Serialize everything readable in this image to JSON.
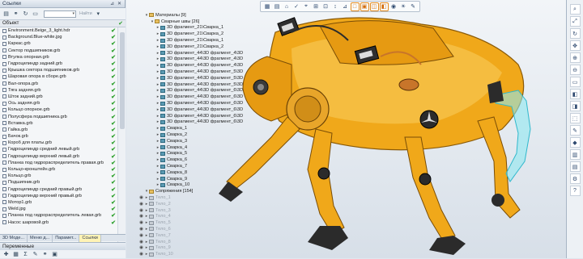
{
  "left_panel": {
    "title": "Ссылки",
    "find_label": "Найти",
    "column_header": "Объект",
    "items": [
      "Environment.Beige_3_light.hdr",
      "Background.Blue-white.jpg",
      "Каркас.grb",
      "Сектор подшипников.grb",
      "Втулка опорная.grb",
      "Гидроцилиндр задний.grb",
      "Крышка сектора подшипников.grb",
      "Шаровая опора в сборе.grb",
      "Вал-опора.grb",
      "Тяга задняя.grb",
      "Шток задний.grb",
      "Ось задняя.grb",
      "Кольцо опорное.grb",
      "Полусфера подшипника.grb",
      "Вставка.grb",
      "Гайка.grb",
      "Бачок.grb",
      "Короб для платы.grb",
      "Гидроцилиндр средний левый.grb",
      "Гидроцилиндр верхний левый.grb",
      "Планка под гидрораспределитель правая.grb",
      "Кольцо-кронштейн.grb",
      "Кольцо.grb",
      "Подшипник.grb",
      "Гидроцилиндр средний правый.grb",
      "Гидроцилиндр верхний правый.grb",
      "Мотор1.grb",
      "Weld.jpg",
      "Планка под гидрораспределитель левая.grb",
      "Насос шаровой.grb"
    ],
    "tabs": [
      "3D Моде...",
      "Меню д...",
      "Парамет...",
      "Ссылки"
    ],
    "bottom_title": "Переменные"
  },
  "tree": {
    "rows": [
      {
        "label": "Материалы [9]",
        "level": 0,
        "type": "fold"
      },
      {
        "label": "Сварные швы [26]",
        "level": 1,
        "type": "fold"
      },
      {
        "label": "3D фрагмент_21\\Сварка_1",
        "level": 2,
        "type": "part"
      },
      {
        "label": "3D фрагмент_21\\Сварка_2",
        "level": 2,
        "type": "part"
      },
      {
        "label": "3D фрагмент_21\\Сварка_1",
        "level": 2,
        "type": "part"
      },
      {
        "label": "3D фрагмент_21\\Сварка_2",
        "level": 2,
        "type": "part"
      },
      {
        "label": "3D фрагмент_44\\3D фрагмент_4\\3D",
        "level": 2,
        "type": "part"
      },
      {
        "label": "3D фрагмент_44\\3D фрагмент_4\\3D",
        "level": 2,
        "type": "part"
      },
      {
        "label": "3D фрагмент_44\\3D фрагмент_4\\3D",
        "level": 2,
        "type": "part"
      },
      {
        "label": "3D фрагмент_44\\3D фрагмент_5\\3D",
        "level": 2,
        "type": "part"
      },
      {
        "label": "3D фрагмент_44\\3D фрагмент_5\\3D",
        "level": 2,
        "type": "part"
      },
      {
        "label": "3D фрагмент_44\\3D фрагмент_5\\3D",
        "level": 2,
        "type": "part"
      },
      {
        "label": "3D фрагмент_44\\3D фрагмент_6\\3D",
        "level": 2,
        "type": "part"
      },
      {
        "label": "3D фрагмент_44\\3D фрагмент_6\\3D",
        "level": 2,
        "type": "part"
      },
      {
        "label": "3D фрагмент_44\\3D фрагмент_6\\3D",
        "level": 2,
        "type": "part"
      },
      {
        "label": "3D фрагмент_44\\3D фрагмент_6\\3D",
        "level": 2,
        "type": "part"
      },
      {
        "label": "3D фрагмент_44\\3D фрагмент_6\\3D",
        "level": 2,
        "type": "part"
      },
      {
        "label": "3D фрагмент_44\\3D фрагмент_6\\3D",
        "level": 2,
        "type": "part"
      },
      {
        "label": "Сварка_1",
        "level": 2,
        "type": "part"
      },
      {
        "label": "Сварка_2",
        "level": 2,
        "type": "part"
      },
      {
        "label": "Сварка_3",
        "level": 2,
        "type": "part"
      },
      {
        "label": "Сварка_4",
        "level": 2,
        "type": "part"
      },
      {
        "label": "Сварка_5",
        "level": 2,
        "type": "part"
      },
      {
        "label": "Сварка_6",
        "level": 2,
        "type": "part"
      },
      {
        "label": "Сварка_7",
        "level": 2,
        "type": "part"
      },
      {
        "label": "Сварка_8",
        "level": 2,
        "type": "part"
      },
      {
        "label": "Сварка_9",
        "level": 2,
        "type": "part"
      },
      {
        "label": "Сварка_10",
        "level": 2,
        "type": "part"
      },
      {
        "label": "Сопряжения [154]",
        "level": 0,
        "type": "fold"
      },
      {
        "label": "Тело_1",
        "level": 0,
        "type": "hid"
      },
      {
        "label": "Тело_2",
        "level": 0,
        "type": "hid"
      },
      {
        "label": "Тело_3",
        "level": 0,
        "type": "hid"
      },
      {
        "label": "Тело_4",
        "level": 0,
        "type": "hid"
      },
      {
        "label": "Тело_5",
        "level": 0,
        "type": "hid"
      },
      {
        "label": "Тело_6",
        "level": 0,
        "type": "hid"
      },
      {
        "label": "Тело_7",
        "level": 0,
        "type": "hid"
      },
      {
        "label": "Тело_8",
        "level": 0,
        "type": "hid"
      },
      {
        "label": "Тело_9",
        "level": 0,
        "type": "hid"
      },
      {
        "label": "Тело_10",
        "level": 0,
        "type": "hid"
      }
    ]
  },
  "colors": {
    "accent": "#e38a1c",
    "body": "#f0a81a",
    "dark": "#2b2b2b",
    "cyan": "#5fd8e8"
  }
}
